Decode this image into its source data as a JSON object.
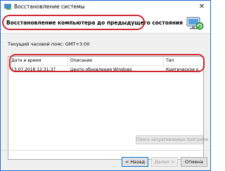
{
  "window": {
    "title": "Восстановление системы",
    "close_glyph": "✕"
  },
  "header": {
    "title": "Восстановление компьютера до предыдущего состояния",
    "icon": "system-restore-icon"
  },
  "timezone_label": "Текущий часовой пояс: GMT+3:00",
  "table": {
    "columns": [
      "Дата и время",
      "Описание",
      "Тип"
    ],
    "rows": [
      [
        "13.07.2018 12:31:37",
        "Центр обновления Windows",
        "Критическое о..."
      ]
    ]
  },
  "buttons": {
    "scan": "Поиск затрагиваемых программ",
    "back": "< Назад",
    "next": "Далее >",
    "cancel": "Отмена"
  },
  "colors": {
    "highlight_ring": "#d0272f",
    "primary_border": "#0078d7"
  }
}
